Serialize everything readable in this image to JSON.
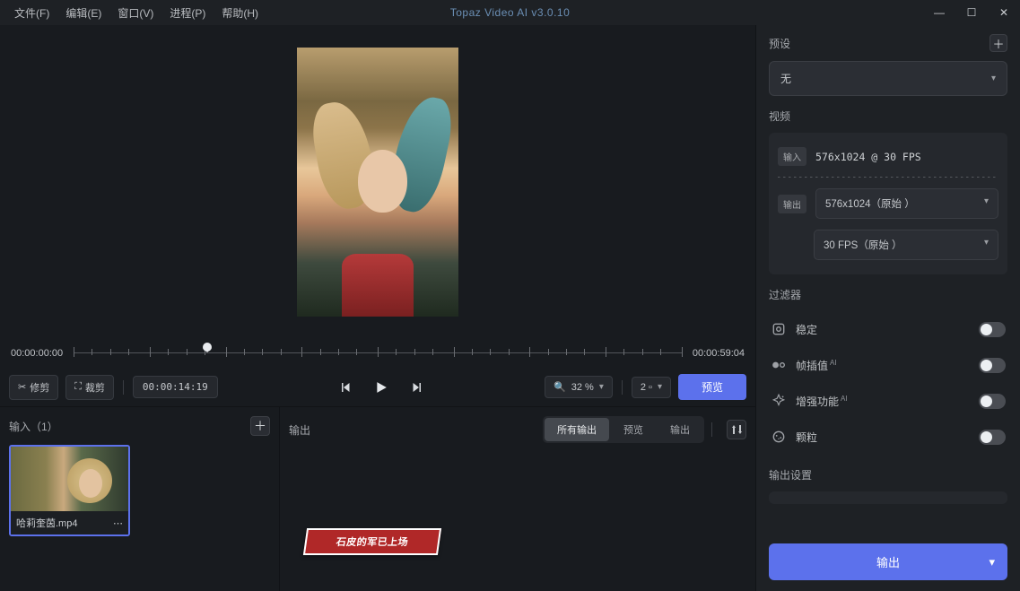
{
  "app": {
    "title": "Topaz Video AI   v3.0.10"
  },
  "menus": {
    "file": "文件(F)",
    "edit": "编辑(E)",
    "window": "窗口(V)",
    "process": "进程(P)",
    "help": "帮助(H)"
  },
  "timeline": {
    "start": "00:00:00:00",
    "end": "00:00:59:04",
    "current": "00:00:14:19"
  },
  "controls": {
    "trim": "修剪",
    "crop": "裁剪",
    "zoom": "32 %",
    "grid": "2 ▫",
    "preview": "预览"
  },
  "io": {
    "input_title": "输入（1）",
    "output_title": "输出",
    "file_name": "哈莉奎茵.mp4",
    "tabs": {
      "all": "所有输出",
      "preview": "预览",
      "output": "输出"
    }
  },
  "right": {
    "presets": {
      "label": "预设",
      "value": "无"
    },
    "video": {
      "label": "视频",
      "input_tag": "输入",
      "input_res": "576x1024 @ 30 FPS",
      "output_tag": "输出",
      "output_res": "576x1024（原始    ）",
      "output_fps": "30 FPS（原始    ）"
    },
    "filters": {
      "label": "过滤器",
      "stabilize": "稳定",
      "interp": "帧插值",
      "enhance": "增强功能",
      "grain": "颗粒",
      "ai": "AI"
    },
    "output_settings": "输出设置",
    "export": "输出"
  },
  "watermark": "石皮的军已上场"
}
